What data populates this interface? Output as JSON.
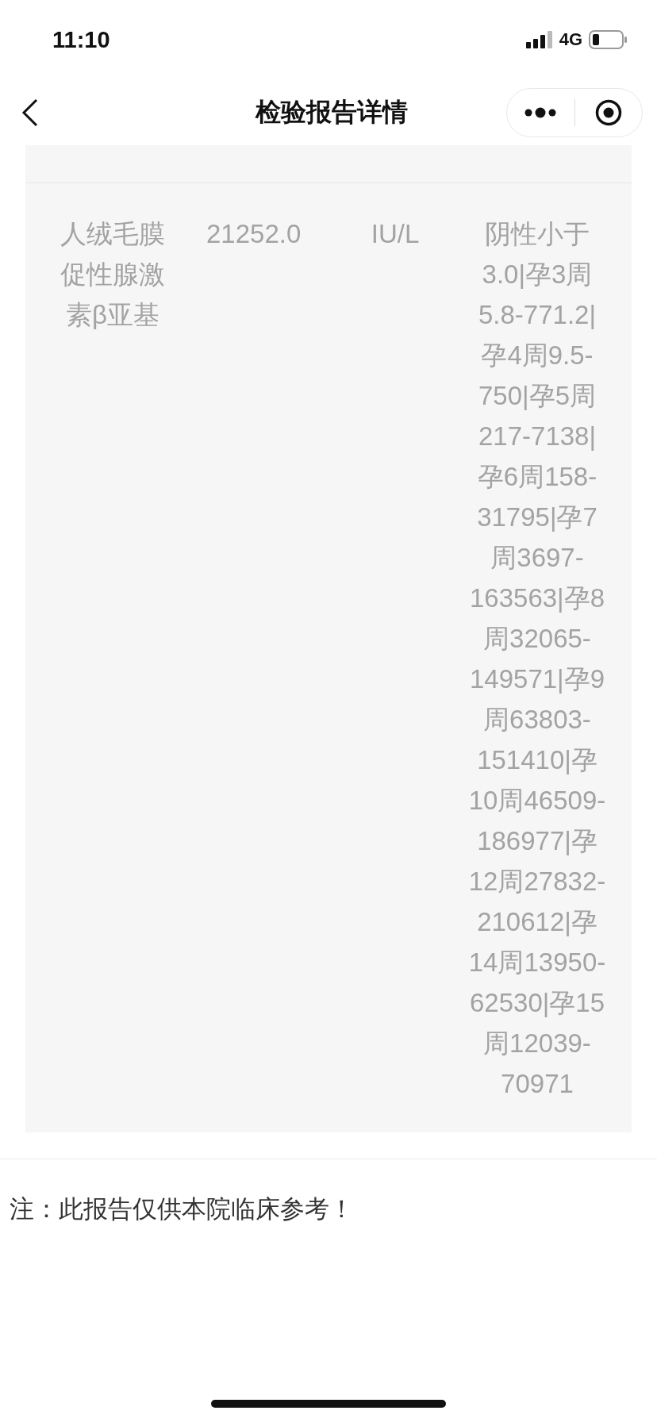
{
  "status_bar": {
    "time": "11:10",
    "network": "4G"
  },
  "nav": {
    "title": "检验报告详情"
  },
  "results": [
    {
      "item": "人绒毛膜促性腺激素β亚基",
      "value": "21252.0",
      "unit": "IU/L",
      "reference_range": "阴性小于3.0|孕3周5.8-771.2|孕4周9.5-750|孕5周217-7138|孕6周158-31795|孕7周3697-163563|孕8周32065-149571|孕9周63803-151410|孕10周46509-186977|孕12周27832-210612|孕14周13950-62530|孕15周12039-70971"
    }
  ],
  "note": "注：此报告仅供本院临床参考！"
}
